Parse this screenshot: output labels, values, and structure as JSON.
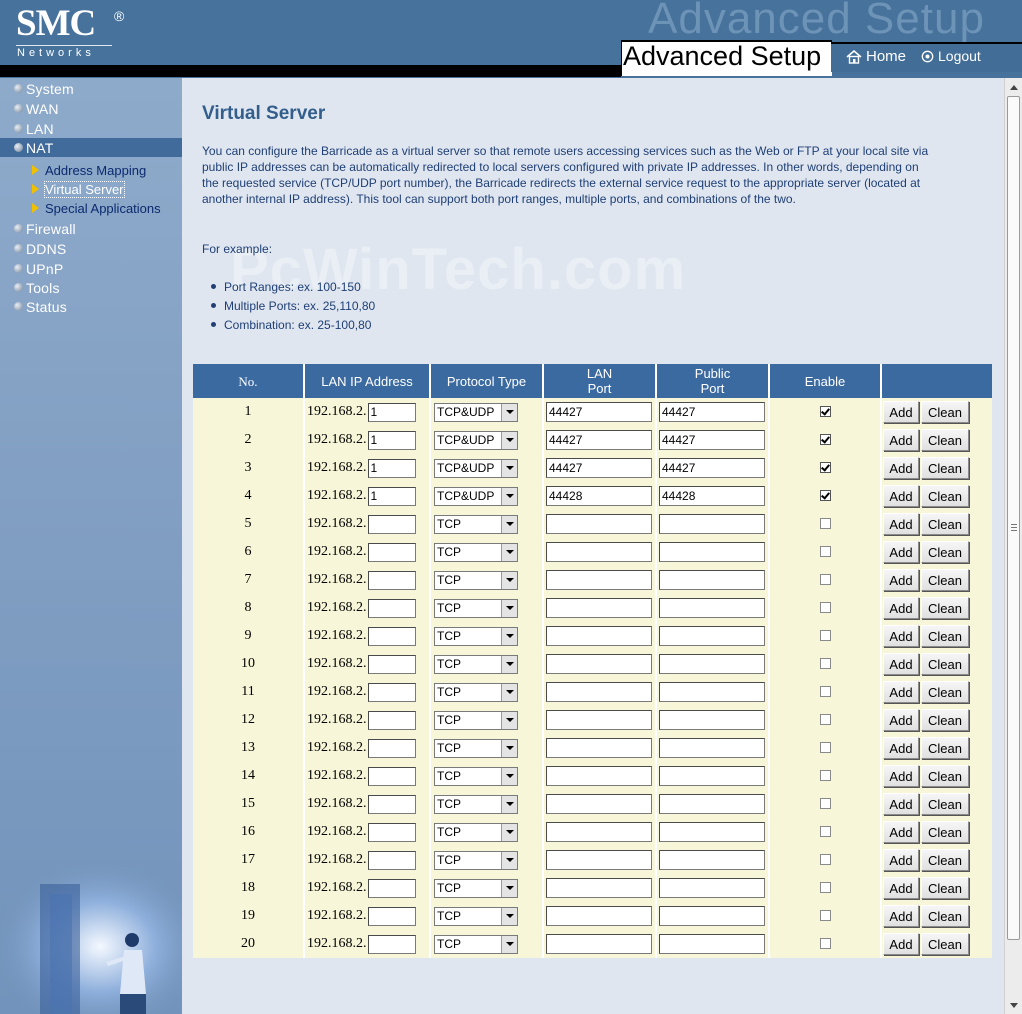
{
  "header": {
    "logo": "SMC",
    "logo_reg": "®",
    "logo_sub": "Networks",
    "watermark_title": "Advanced Setup",
    "title": "Advanced Setup",
    "home": "Home",
    "logout": "Logout"
  },
  "sidebar": {
    "items": [
      {
        "label": "System",
        "active": false
      },
      {
        "label": "WAN",
        "active": false
      },
      {
        "label": "LAN",
        "active": false
      },
      {
        "label": "NAT",
        "active": true
      },
      {
        "label": "Firewall",
        "active": false
      },
      {
        "label": "DDNS",
        "active": false
      },
      {
        "label": "UPnP",
        "active": false
      },
      {
        "label": "Tools",
        "active": false
      },
      {
        "label": "Status",
        "active": false
      }
    ],
    "nat_sub": [
      "Address Mapping",
      "Virtual Server",
      "Special Applications"
    ]
  },
  "content": {
    "title": "Virtual Server",
    "intro": "You can configure the Barricade as a virtual server so that remote users accessing services such as the Web or FTP at your local site via public IP addresses can be automatically redirected to local servers configured with private IP addresses. In other words, depending on the requested service (TCP/UDP port number), the Barricade redirects the external service request to the appropriate server (located at another internal IP address). This tool can support both port ranges, multiple ports, and combinations of the two.",
    "example_label": "For example:",
    "examples": [
      "Port Ranges: ex. 100-150",
      "Multiple Ports: ex. 25,110,80",
      "Combination: ex. 25-100,80"
    ],
    "watermark": "PcWinTech.com"
  },
  "table": {
    "headers": {
      "no": "No.",
      "lan_ip": "LAN IP Address",
      "protocol": "Protocol Type",
      "lan_port_1": "LAN",
      "lan_port_2": "Port",
      "public_port_1": "Public",
      "public_port_2": "Port",
      "enable": "Enable"
    },
    "ip_prefix": "192.168.2.",
    "add_label": "Add",
    "clean_label": "Clean",
    "rows": [
      {
        "no": "1",
        "ip": "1",
        "protocol": "TCP&UDP",
        "lan_port": "44427",
        "public_port": "44427",
        "enabled": true
      },
      {
        "no": "2",
        "ip": "1",
        "protocol": "TCP&UDP",
        "lan_port": "44427",
        "public_port": "44427",
        "enabled": true
      },
      {
        "no": "3",
        "ip": "1",
        "protocol": "TCP&UDP",
        "lan_port": "44427",
        "public_port": "44427",
        "enabled": true
      },
      {
        "no": "4",
        "ip": "1",
        "protocol": "TCP&UDP",
        "lan_port": "44428",
        "public_port": "44428",
        "enabled": true
      },
      {
        "no": "5",
        "ip": "",
        "protocol": "TCP",
        "lan_port": "",
        "public_port": "",
        "enabled": false
      },
      {
        "no": "6",
        "ip": "",
        "protocol": "TCP",
        "lan_port": "",
        "public_port": "",
        "enabled": false
      },
      {
        "no": "7",
        "ip": "",
        "protocol": "TCP",
        "lan_port": "",
        "public_port": "",
        "enabled": false
      },
      {
        "no": "8",
        "ip": "",
        "protocol": "TCP",
        "lan_port": "",
        "public_port": "",
        "enabled": false
      },
      {
        "no": "9",
        "ip": "",
        "protocol": "TCP",
        "lan_port": "",
        "public_port": "",
        "enabled": false
      },
      {
        "no": "10",
        "ip": "",
        "protocol": "TCP",
        "lan_port": "",
        "public_port": "",
        "enabled": false
      },
      {
        "no": "11",
        "ip": "",
        "protocol": "TCP",
        "lan_port": "",
        "public_port": "",
        "enabled": false
      },
      {
        "no": "12",
        "ip": "",
        "protocol": "TCP",
        "lan_port": "",
        "public_port": "",
        "enabled": false
      },
      {
        "no": "13",
        "ip": "",
        "protocol": "TCP",
        "lan_port": "",
        "public_port": "",
        "enabled": false
      },
      {
        "no": "14",
        "ip": "",
        "protocol": "TCP",
        "lan_port": "",
        "public_port": "",
        "enabled": false
      },
      {
        "no": "15",
        "ip": "",
        "protocol": "TCP",
        "lan_port": "",
        "public_port": "",
        "enabled": false
      },
      {
        "no": "16",
        "ip": "",
        "protocol": "TCP",
        "lan_port": "",
        "public_port": "",
        "enabled": false
      },
      {
        "no": "17",
        "ip": "",
        "protocol": "TCP",
        "lan_port": "",
        "public_port": "",
        "enabled": false
      },
      {
        "no": "18",
        "ip": "",
        "protocol": "TCP",
        "lan_port": "",
        "public_port": "",
        "enabled": false
      },
      {
        "no": "19",
        "ip": "",
        "protocol": "TCP",
        "lan_port": "",
        "public_port": "",
        "enabled": false
      },
      {
        "no": "20",
        "ip": "",
        "protocol": "TCP",
        "lan_port": "",
        "public_port": "",
        "enabled": false
      }
    ]
  },
  "colors": {
    "header_bg": "#46729c",
    "sidebar_bg": "#8eaacb",
    "content_bg": "#dfe6f0",
    "table_header_bg": "#3b6aa1",
    "row_bg": "#f8f6d9",
    "title_color": "#335e8c"
  },
  "icons": {
    "home": "home-icon",
    "logout": "power-icon",
    "bullet": "bullet-icon",
    "sub_arrow": "triangle-right-icon"
  }
}
